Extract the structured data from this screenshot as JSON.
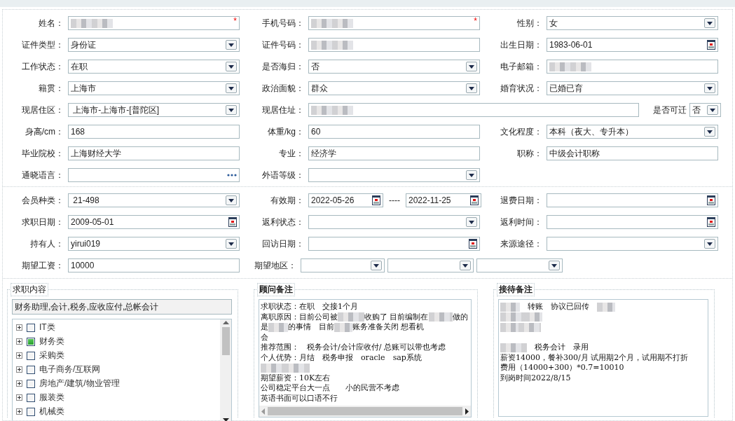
{
  "profile_rows": [
    [
      {
        "label": "姓名：",
        "kind": "text",
        "redacted": true,
        "required_mark": "*"
      },
      {
        "label": "手机号码：",
        "kind": "text",
        "redacted": true,
        "required_mark": "*"
      },
      {
        "label": "性别：",
        "kind": "select",
        "value": "女"
      }
    ],
    [
      {
        "label": "证件类型：",
        "kind": "select",
        "value": "身份证"
      },
      {
        "label": "证件号码：",
        "kind": "text",
        "redacted": true
      },
      {
        "label": "出生日期：",
        "kind": "date",
        "value": "1983-06-01"
      }
    ],
    [
      {
        "label": "工作状态：",
        "kind": "select",
        "value": "在职"
      },
      {
        "label": "是否海归：",
        "kind": "select",
        "value": "否"
      },
      {
        "label": "电子邮箱：",
        "kind": "text",
        "redacted": true
      }
    ],
    [
      {
        "label": "籍贯：",
        "kind": "select",
        "value": "上海市"
      },
      {
        "label": "政治面貌：",
        "kind": "select",
        "value": "群众"
      },
      {
        "label": "婚育状况：",
        "kind": "select",
        "value": "已婚已育"
      }
    ],
    [
      {
        "label": "现居住区：",
        "kind": "select",
        "value": " 上海市-上海市-[普陀区]"
      },
      {
        "label": "现居住址：",
        "kind": "text",
        "redacted": true,
        "attached": {
          "label": "是否可迁",
          "kind": "select",
          "value": "否"
        }
      }
    ],
    [
      {
        "label": "身高/cm：",
        "kind": "text",
        "value": "168"
      },
      {
        "label": "体重/kg：",
        "kind": "text",
        "value": "60"
      },
      {
        "label": "文化程度：",
        "kind": "select",
        "value": "本科（夜大、专升本）"
      }
    ],
    [
      {
        "label": "毕业院校：",
        "kind": "text",
        "value": "上海财经大学"
      },
      {
        "label": "专业：",
        "kind": "text",
        "value": "经济学"
      },
      {
        "label": "职称：",
        "kind": "text",
        "value": "中级会计职称"
      }
    ],
    [
      {
        "label": "通晓语言：",
        "kind": "lookup"
      },
      {
        "label": "外语等级：",
        "kind": "select"
      }
    ]
  ],
  "member_rows": [
    [
      {
        "label": "会员种类：",
        "kind": "select",
        "value": " 21-498"
      },
      {
        "label": "有效期：",
        "kind": "date_range",
        "values": [
          "2022-05-26",
          "2022-11-25"
        ],
        "separator": "----"
      },
      {
        "label": "退费日期：",
        "kind": "date"
      }
    ],
    [
      {
        "label": "求职日期：",
        "kind": "date",
        "value": "2009-05-01"
      },
      {
        "label": "返利状态：",
        "kind": "select"
      },
      {
        "label": "返利时间：",
        "kind": "date"
      }
    ],
    [
      {
        "label": "持有人：",
        "kind": "select",
        "value": "yirui019"
      },
      {
        "label": "回访日期：",
        "kind": "date"
      },
      {
        "label": "来源途径：",
        "kind": "select"
      }
    ],
    [
      {
        "label": "期望工资：",
        "kind": "text",
        "value": "10000"
      },
      {
        "label": "期望地区：",
        "kind": "select_group",
        "selects": [
          {
            "kind": "select"
          },
          {
            "kind": "select"
          },
          {
            "kind": "select"
          }
        ]
      }
    ]
  ],
  "job_content": {
    "title": "求职内容",
    "summary": "财务助理,会计,税务,应收应付,总帐会计",
    "tree": [
      {
        "label": "IT类",
        "checked": false,
        "expanded": false
      },
      {
        "label": "财务类",
        "checked": true,
        "expanded": false
      },
      {
        "label": "采购类",
        "checked": false,
        "expanded": false
      },
      {
        "label": "电子商务/互联网",
        "checked": false,
        "expanded": false
      },
      {
        "label": "房地产/建筑/物业管理",
        "checked": false,
        "expanded": false
      },
      {
        "label": "服装类",
        "checked": false,
        "expanded": false
      },
      {
        "label": "机械类",
        "checked": false,
        "expanded": false
      }
    ]
  },
  "notes": [
    {
      "title": "顾问备注",
      "scrollbar": true,
      "lines": [
        [
          {
            "kind": "text",
            "text": "求职状态：在职　交接1个月"
          }
        ],
        [
          {
            "kind": "text",
            "text": "离职原因：目前公司被"
          },
          {
            "kind": "blur"
          },
          {
            "kind": "text",
            "text": "收购了 目前编制在"
          },
          {
            "kind": "blur"
          },
          {
            "kind": "text",
            "text": "做的"
          }
        ],
        [
          {
            "kind": "text",
            "text": "是"
          },
          {
            "kind": "blur"
          },
          {
            "kind": "text",
            "text": "的事情　目前"
          },
          {
            "kind": "blur"
          },
          {
            "kind": "text",
            "text": "账务准备关闭 想看机"
          }
        ],
        [
          {
            "kind": "text",
            "text": "会"
          }
        ],
        [
          {
            "kind": "text",
            "text": "推荐范围：　税务会计/会计应收付/ 总账可以带也考虑"
          }
        ],
        [
          {
            "kind": "text",
            "text": "个人优势：月结　税务申报　oracle　sap系统"
          }
        ],
        [
          {
            "kind": "blur"
          },
          {
            "kind": "blur"
          }
        ],
        [
          {
            "kind": "text",
            "text": "期望薪资：10K左右"
          }
        ],
        [
          {
            "kind": "text",
            "text": "公司稳定平台大一点　　小的民营不考虑"
          }
        ],
        [
          {
            "kind": "text",
            "text": "英语书面可以口语不行"
          }
        ]
      ]
    },
    {
      "title": "接待备注",
      "scrollbar": false,
      "lines": [
        [
          {
            "kind": "blur"
          },
          {
            "kind": "text",
            "text": "　转账　协议已回传　"
          },
          {
            "kind": "blur"
          }
        ],
        [
          {
            "kind": "blur"
          },
          {
            "kind": "blur"
          }
        ],
        [
          {
            "kind": "blur"
          },
          {
            "kind": "blur"
          }
        ],
        [
          {
            "kind": "blank"
          }
        ],
        [
          {
            "kind": "blur"
          },
          {
            "kind": "text",
            "text": "　税务会计　录用"
          }
        ],
        [
          {
            "kind": "text",
            "text": "薪资14000，餐补300/月 试用期2个月，试用期不打折"
          }
        ],
        [
          {
            "kind": "text",
            "text": "费用（14000+300）*0.7=10010"
          }
        ],
        [
          {
            "kind": "text",
            "text": "到岗时间2022/8/15"
          }
        ]
      ]
    }
  ]
}
